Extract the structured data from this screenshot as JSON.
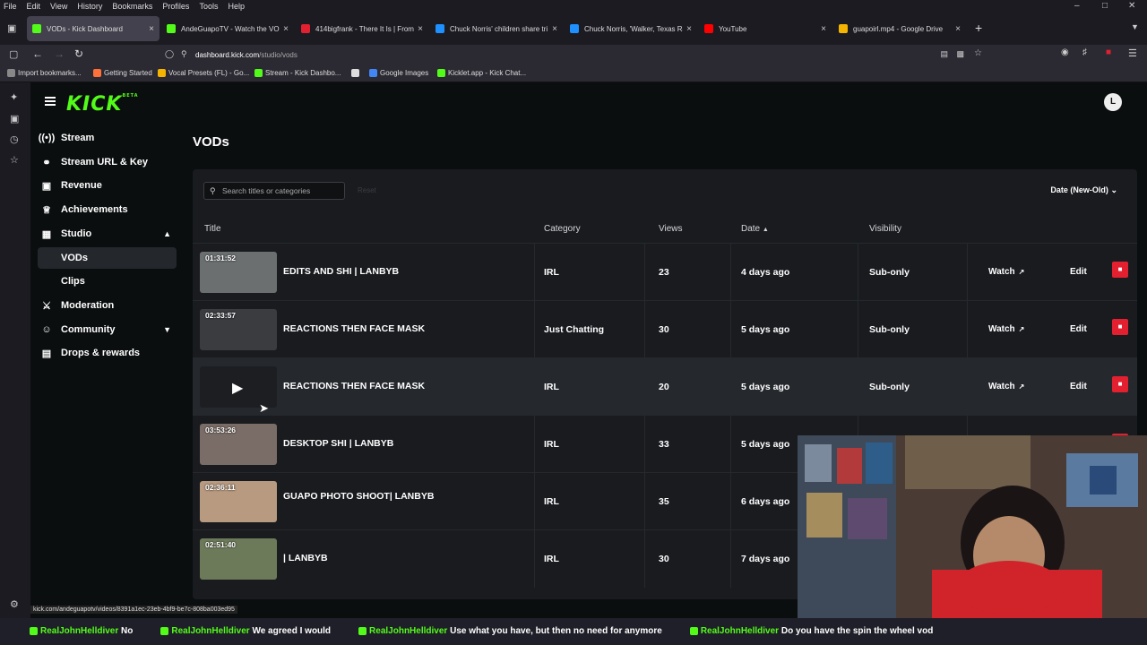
{
  "browser": {
    "menu": [
      "File",
      "Edit",
      "View",
      "History",
      "Bookmarks",
      "Profiles",
      "Tools",
      "Help"
    ],
    "window_controls": [
      "–",
      "□",
      "✕"
    ],
    "tabs": [
      {
        "title": "VODs - Kick Dashboard",
        "favicon": "kick-icon",
        "color": "#53fc18"
      },
      {
        "title": "AndeGuapoTV - Watch the VO",
        "favicon": "kick-icon",
        "color": "#53fc18"
      },
      {
        "title": "414bigfrank - There It Is | From",
        "favicon": "video-icon",
        "color": "#e3202f"
      },
      {
        "title": "Chuck Norris' children share tri",
        "favicon": "news-icon",
        "color": "#1e90ff"
      },
      {
        "title": "Chuck Norris, 'Walker, Texas Ra",
        "favicon": "news-icon",
        "color": "#1e90ff"
      },
      {
        "title": "YouTube",
        "favicon": "youtube-icon",
        "color": "#ff0000"
      },
      {
        "title": "guapoirl.mp4 - Google Drive",
        "favicon": "drive-icon",
        "color": "#f4b400"
      }
    ],
    "new_tab": "+",
    "url_domain": "dashboard.kick.com",
    "url_path": "/studio/vods",
    "bookmarks": [
      {
        "label": "Import bookmarks...",
        "color": "#888"
      },
      {
        "label": "Getting Started",
        "color": "#ff7139"
      },
      {
        "label": "Vocal Presets (FL) - Go...",
        "color": "#f4b400"
      },
      {
        "label": "Stream - Kick Dashbo...",
        "color": "#53fc18"
      },
      {
        "label": "",
        "color": "#ddd"
      },
      {
        "label": "Google Images",
        "color": "#4285f4"
      },
      {
        "label": "Kicklet.app - Kick Chat...",
        "color": "#53fc18"
      }
    ],
    "status_url": "kick.com/andeguapotv/videos/8391a1ec-23eb-4bf9-be7c-808ba003ed95"
  },
  "brand": {
    "logo": "KICK",
    "beta": "BETA",
    "avatar": "L",
    "accent": "#53fc18"
  },
  "sidebar": {
    "items": [
      {
        "label": "Stream",
        "icon": "broadcast-icon",
        "glyph": "((•))"
      },
      {
        "label": "Stream URL & Key",
        "icon": "link-icon",
        "glyph": "⚭"
      },
      {
        "label": "Revenue",
        "icon": "revenue-icon",
        "glyph": "▣"
      },
      {
        "label": "Achievements",
        "icon": "trophy-icon",
        "glyph": "♕"
      },
      {
        "label": "Studio",
        "icon": "studio-icon",
        "glyph": "▦",
        "chevron": "▲"
      },
      {
        "label": "VODs",
        "sub": true,
        "selected": true
      },
      {
        "label": "Clips",
        "sub": true
      },
      {
        "label": "Moderation",
        "icon": "sword-icon",
        "glyph": "⚔"
      },
      {
        "label": "Community",
        "icon": "community-icon",
        "glyph": "☺",
        "chevron": "▼"
      },
      {
        "label": "Drops & rewards",
        "icon": "gift-icon",
        "glyph": "▤"
      }
    ]
  },
  "page": {
    "title": "VODs",
    "search_placeholder": "Search titles or categories",
    "reset": "Reset",
    "sort": "Date (New-Old)",
    "columns": {
      "title": "Title",
      "category": "Category",
      "views": "Views",
      "date": "Date",
      "date_sort": "▲",
      "visibility": "Visibility"
    },
    "watch_label": "Watch",
    "edit_label": "Edit",
    "rows": [
      {
        "duration": "01:31:52",
        "title": "EDITS AND SHI | LANBYB",
        "category": "IRL",
        "views": "23",
        "date": "4 days ago",
        "visibility": "Sub-only",
        "thumb": "#6b6f70"
      },
      {
        "duration": "02:33:57",
        "title": "REACTIONS THEN FACE MASK",
        "category": "Just Chatting",
        "views": "30",
        "date": "5 days ago",
        "visibility": "Sub-only",
        "thumb": "#3a3c40"
      },
      {
        "duration": "",
        "title": "REACTIONS THEN FACE MASK",
        "category": "IRL",
        "views": "20",
        "date": "5 days ago",
        "visibility": "Sub-only",
        "thumb": "#1c1e21",
        "hover": true
      },
      {
        "duration": "03:53:26",
        "title": "DESKTOP SHI | LANBYB",
        "category": "IRL",
        "views": "33",
        "date": "5 days ago",
        "visibility": "",
        "thumb": "#7a6c66"
      },
      {
        "duration": "02:36:11",
        "title": "GUAPO PHOTO SHOOT| LANBYB",
        "category": "IRL",
        "views": "35",
        "date": "6 days ago",
        "visibility": "",
        "thumb": "#b89a80"
      },
      {
        "duration": "02:51:40",
        "title": "| LANBYB",
        "category": "IRL",
        "views": "30",
        "date": "7 days ago",
        "visibility": "",
        "thumb": "#6d7a5a"
      }
    ]
  },
  "chat_ticker": [
    {
      "name": "RealJohnHelldiver",
      "msg": "No"
    },
    {
      "name": "RealJohnHelldiver",
      "msg": "We agreed I would"
    },
    {
      "name": "RealJohnHelldiver",
      "msg": "Use what you have, but then no need for anymore"
    },
    {
      "name": "RealJohnHelldiver",
      "msg": "Do you have the spin the wheel vod"
    }
  ]
}
